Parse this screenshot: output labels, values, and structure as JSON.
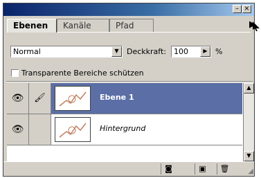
{
  "titlebar": {
    "minimize_label": "–",
    "close_label": "×"
  },
  "tabs": [
    {
      "label": "Ebenen",
      "active": true
    },
    {
      "label": "Kanäle",
      "active": false
    },
    {
      "label": "Pfad",
      "active": false
    }
  ],
  "panel_menu_icon": "triangle-right-icon",
  "blend_mode": {
    "value": "Normal"
  },
  "opacity": {
    "label": "Deckkraft:",
    "value": "100",
    "unit": "%"
  },
  "transparency_lock": {
    "label": "Transparente Bereiche schützen",
    "checked": false
  },
  "layers": [
    {
      "name": "Ebene 1",
      "selected": true,
      "visible": true,
      "brush": true
    },
    {
      "name": "Hintergrund",
      "selected": false,
      "visible": true,
      "brush": false
    }
  ],
  "icons": {
    "eye": "eye-icon",
    "brush": "brush-icon",
    "mask": "mask-icon",
    "new_layer": "new-layer-icon",
    "trash": "trash-icon"
  },
  "colors": {
    "panel_bg": "#d4d0c8",
    "selection": "#5b6fa6",
    "titlebar_start": "#0a246a",
    "titlebar_end": "#a6caf0"
  }
}
